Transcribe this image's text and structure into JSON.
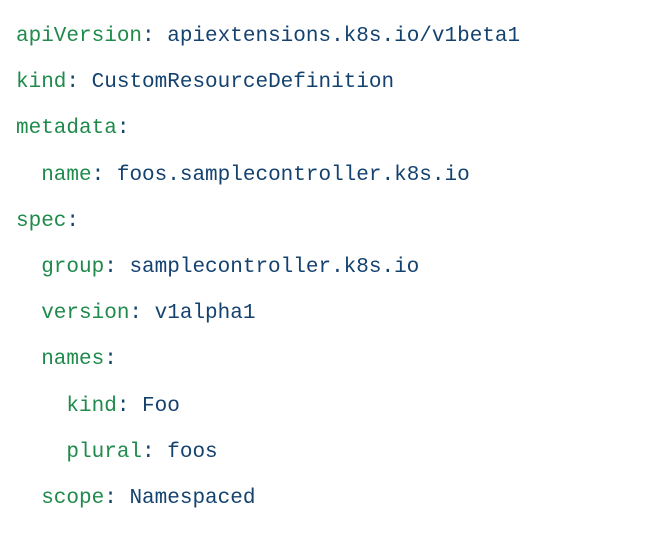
{
  "code": {
    "l0": {
      "key": "apiVersion",
      "value": "apiextensions.k8s.io/v1beta1"
    },
    "l1": {
      "key": "kind",
      "value": "CustomResourceDefinition"
    },
    "l2": {
      "key": "metadata",
      "value": ""
    },
    "l3": {
      "key": "name",
      "value": "foos.samplecontroller.k8s.io"
    },
    "l4": {
      "key": "spec",
      "value": ""
    },
    "l5": {
      "key": "group",
      "value": "samplecontroller.k8s.io"
    },
    "l6": {
      "key": "version",
      "value": "v1alpha1"
    },
    "l7": {
      "key": "names",
      "value": ""
    },
    "l8": {
      "key": "kind",
      "value": "Foo"
    },
    "l9": {
      "key": "plural",
      "value": "foos"
    },
    "l10": {
      "key": "scope",
      "value": "Namespaced"
    }
  },
  "colors": {
    "key": "#1f8a4b",
    "value": "#14426f",
    "background": "#ffffff"
  }
}
